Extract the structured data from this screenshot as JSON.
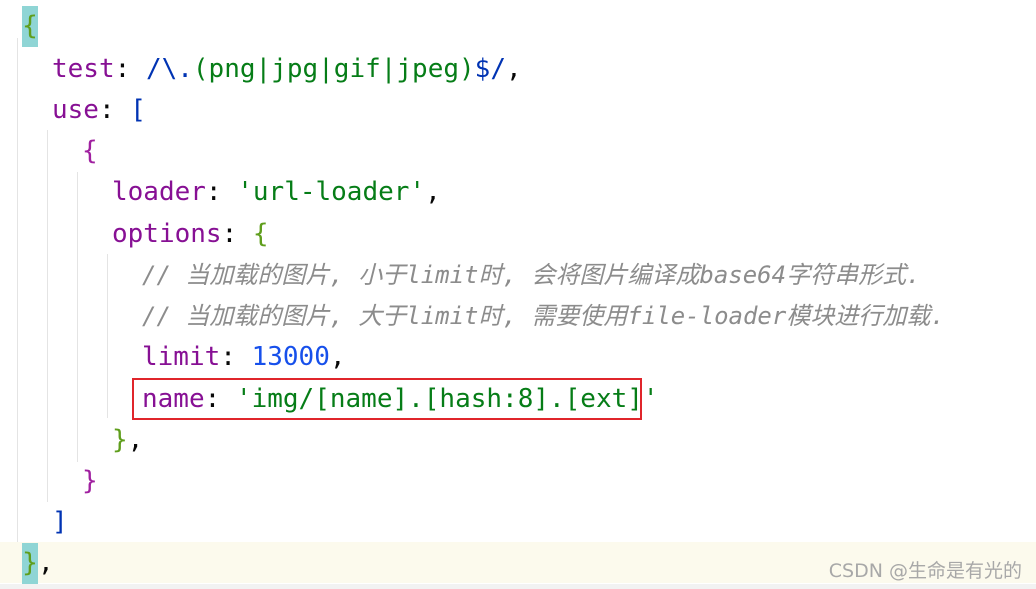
{
  "code": {
    "line1": {
      "open_brace": "{"
    },
    "line2": {
      "key": "test",
      "colon": ":",
      "regex_prefix": "/\\.",
      "regex_group": "(png|jpg|gif|jpeg)",
      "regex_suffix": "$/",
      "comma": ","
    },
    "line3": {
      "key": "use",
      "colon": ":",
      "open_bracket": "["
    },
    "line4": {
      "open_brace": "{"
    },
    "line5": {
      "key": "loader",
      "colon": ":",
      "value": "'url-loader'",
      "comma": ","
    },
    "line6": {
      "key": "options",
      "colon": ":",
      "open_brace": "{"
    },
    "line7": {
      "comment": "// 当加载的图片, 小于limit时, 会将图片编译成base64字符串形式."
    },
    "line8": {
      "comment": "// 当加载的图片, 大于limit时, 需要使用file-loader模块进行加载."
    },
    "line9": {
      "key": "limit",
      "colon": ":",
      "value": "13000",
      "comma": ","
    },
    "line10": {
      "key": "name",
      "colon": ":",
      "value": "'img/[name].[hash:8].[ext]'"
    },
    "line11": {
      "close": "}",
      "comma": ","
    },
    "line12": {
      "close": "}"
    },
    "line13": {
      "close": "]"
    },
    "line14": {
      "close": "}",
      "comma": ","
    }
  },
  "watermark": "CSDN @生命是有光的",
  "colors": {
    "key": "#871094",
    "string": "#067d17",
    "number": "#1750eb",
    "comment": "#8c8c8c",
    "highlight_box": "#e0252b",
    "current_line": "#fcfaed",
    "brace_match_bg": "#8fd5d5"
  }
}
